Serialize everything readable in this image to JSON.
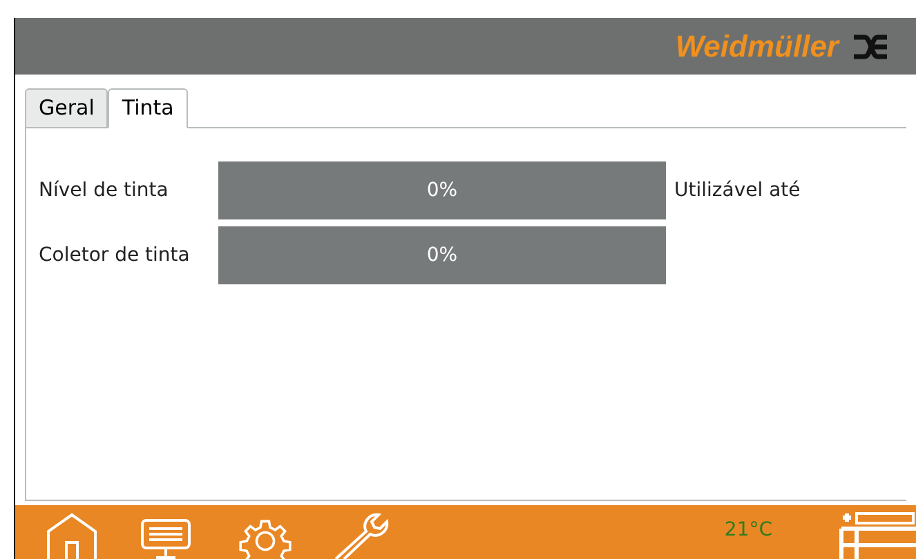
{
  "header": {
    "logo": "Weidmüller"
  },
  "tabs": [
    {
      "label": "Geral",
      "selected": false
    },
    {
      "label": "Tinta",
      "selected": true
    }
  ],
  "meters": [
    {
      "label": "Nível de tinta",
      "level": 0,
      "reading": "0%",
      "note": "Utilizável até"
    },
    {
      "label": "Coletor de tinta",
      "level": 0,
      "reading": "0%"
    }
  ],
  "footer": {
    "temperature": "21°C"
  }
}
